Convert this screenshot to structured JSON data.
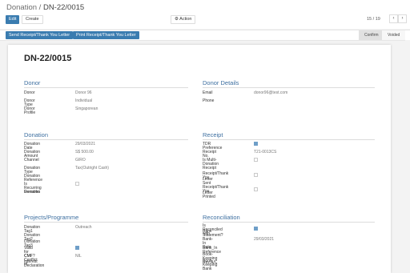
{
  "breadcrumb": {
    "parent": "Donation",
    "separator": "/",
    "current": "DN-22/0015"
  },
  "toolbar": {
    "edit": "Edit",
    "create": "Create",
    "action": "Action"
  },
  "pager": {
    "text": "15 / 19",
    "prev": "‹",
    "next": "›"
  },
  "actions": {
    "send_receipt": "Send Receipt/Thank You Letter",
    "print_receipt": "Print Receipt/Thank You Letter"
  },
  "statusbar": {
    "confirm": "Confirm",
    "voided": "Voided"
  },
  "record": {
    "title": "DN-22/0015"
  },
  "sections": {
    "donor": "Donor",
    "donor_details": "Donor Details",
    "donation": "Donation",
    "receipt": "Receipt",
    "projects": "Projects/Programme",
    "reconciliation": "Reconciliation"
  },
  "donor": {
    "donor_label": "Donor",
    "donor_value": "Donor 96",
    "type_label": "Donor Type",
    "type_value": "Individual",
    "profile_label": "Donor Profile",
    "profile_value": "Singaporean"
  },
  "donor_details": {
    "email_label": "Email",
    "email_value": "donor96@test.com",
    "phone_label": "Phone"
  },
  "donation": {
    "date_label": "Donation Date",
    "date_value": "29/03/2021",
    "amount_label": "Donation Amount",
    "amount_value": "S$ 500.00",
    "channel_label": "Channel",
    "channel_value": "GIRO",
    "type_label": "Donation Type",
    "type_value": "Tax(Outright Cash)",
    "reference_label": "Donation Reference",
    "recurring_label": "Is Recurring Donation",
    "remarks_label": "Remarks"
  },
  "receipt": {
    "tdr_label": "TDR Preference",
    "no_label": "Receipt No.",
    "no_value": "T21-0013CS",
    "multi_label": "Is Multi-Donation",
    "sent_label_1": "Receipt",
    "sent_label_2": "Receipt/Thank You",
    "sent_label_3": "Letter Sent",
    "printed_label_1": "Receipt/Thank You",
    "printed_label_2": "Letter Printed"
  },
  "projects": {
    "tag1_label": "Donation Tag1",
    "tag1_value": "Outreach",
    "tag2_label": "Donation Tag2",
    "tag3_label": "Donation Tag3",
    "cmf_label": "Valid for CMF?",
    "coi_label_1": "CMF Conflict of",
    "coi_label_2": "Interest Declaration",
    "coi_value": "NIL"
  },
  "reconciliation": {
    "reconciled_label_1": "Is Reconciled with",
    "reconciled_label_2": "Bank Statement?",
    "bankin_label": "Bank-In Date",
    "bankin_value": "29/03/2021",
    "bankin_ref_label": "Bank_In Reference",
    "rev_label": "Book-Keeping Rev A/C",
    "bank_label": "Book-Keeping Bank"
  },
  "colors": {
    "primary": "#3a7cb0",
    "section": "#3d6fa0",
    "checked": "#6f9fc8"
  }
}
